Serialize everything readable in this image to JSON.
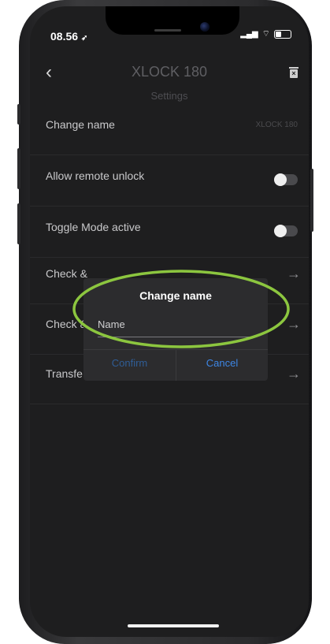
{
  "status": {
    "time": "08.56"
  },
  "nav": {
    "title": "XLOCK 180",
    "subtitle": "Settings",
    "back_icon": "chevron-left-icon",
    "delete_icon": "trash-icon"
  },
  "rows": [
    {
      "label": "Change name",
      "value": "XLOCK 180"
    },
    {
      "label": "Allow remote unlock",
      "toggle": false
    },
    {
      "label": "Toggle Mode active",
      "toggle": false
    },
    {
      "label": "Check &"
    },
    {
      "label": "Check &"
    },
    {
      "label": "Transfe"
    }
  ],
  "dialog": {
    "title": "Change name",
    "placeholder": "Name",
    "confirm_label": "Confirm",
    "cancel_label": "Cancel"
  },
  "colors": {
    "highlight": "#8cc63f",
    "background": "#1e1e1f",
    "accent": "#3d86e5"
  }
}
